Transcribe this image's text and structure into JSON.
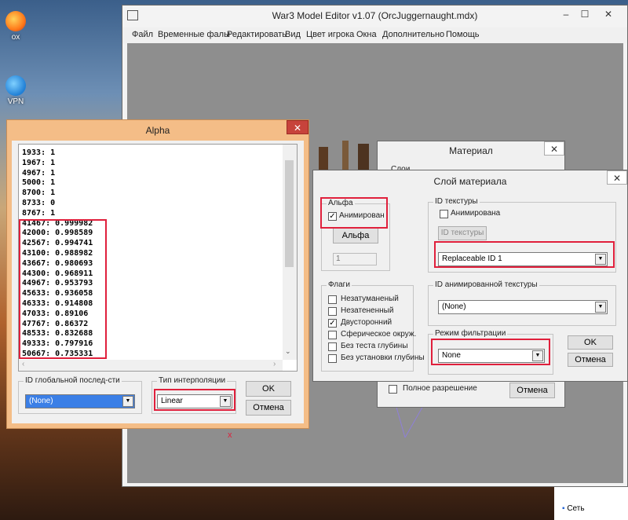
{
  "desktop": {
    "icon1_label": "ox",
    "icon2_label": "VPN",
    "network_label": "Сеть"
  },
  "main_window": {
    "title": "War3 Model Editor v1.07 (OrcJuggernaught.mdx)",
    "menu": [
      "Файл",
      "Временные фалы",
      "Редактировать",
      "Вид",
      "Цвет игрока",
      "Окна",
      "Дополнительно",
      "Помощь"
    ],
    "controls": {
      "minimize": "–",
      "maximize": "☐",
      "close": "✕"
    }
  },
  "alpha_window": {
    "title": "Alpha",
    "close": "✕",
    "lines": [
      "1933: 1",
      "1967: 1",
      "4967: 1",
      "5000: 1",
      "8700: 1",
      "8733: 0",
      "8767: 1",
      "41467: 0.999982",
      "42000: 0.998589",
      "42567: 0.994741",
      "43100: 0.988982",
      "43667: 0.980693",
      "44300: 0.968911",
      "44967: 0.953793",
      "45633: 0.936058",
      "46333: 0.914808",
      "47033: 0.89106",
      "47767: 0.86372",
      "48533: 0.832688",
      "49333: 0.797916",
      "50667: 0.735331"
    ],
    "global_seq_label": "ID глобальной послед-сти",
    "global_seq_value": "(None)",
    "interp_label": "Тип интерполяции",
    "interp_value": "Linear",
    "ok": "OK",
    "cancel": "Отмена"
  },
  "material_window": {
    "title": "Материал",
    "close": "✕",
    "layers_label": "Слои",
    "full_res_label": "Полное разрешение",
    "cancel": "Отмена"
  },
  "layer_window": {
    "title": "Слой материала",
    "close": "✕",
    "alpha_group": "Альфа",
    "animated_label": "Анимирован",
    "alpha_button": "Альфа",
    "alpha_value": "1",
    "texture_id_group": "ID текстуры",
    "texture_animated_label": "Анимирована",
    "texture_id_button": "ID текстуры",
    "texture_value": "Replaceable ID 1",
    "anim_texture_group": "ID анимированной текстуры",
    "anim_texture_value": "(None)",
    "flags_group": "Флаги",
    "flags": [
      {
        "label": "Незатуманеный",
        "checked": false
      },
      {
        "label": "Незатененный",
        "checked": false
      },
      {
        "label": "Двусторонний",
        "checked": true
      },
      {
        "label": "Сферическое окруж.",
        "checked": false
      },
      {
        "label": "Без теста глубины",
        "checked": false
      },
      {
        "label": "Без установки глубины",
        "checked": false
      }
    ],
    "filter_group": "Режим фильтрации",
    "filter_value": "None",
    "ok": "OK",
    "cancel": "Отмена"
  },
  "annotation_marker": "x",
  "colors": {
    "highlight": "#e0203c",
    "alpha_title_bg": "#f4bd87",
    "selection": "#3b7fe6"
  }
}
